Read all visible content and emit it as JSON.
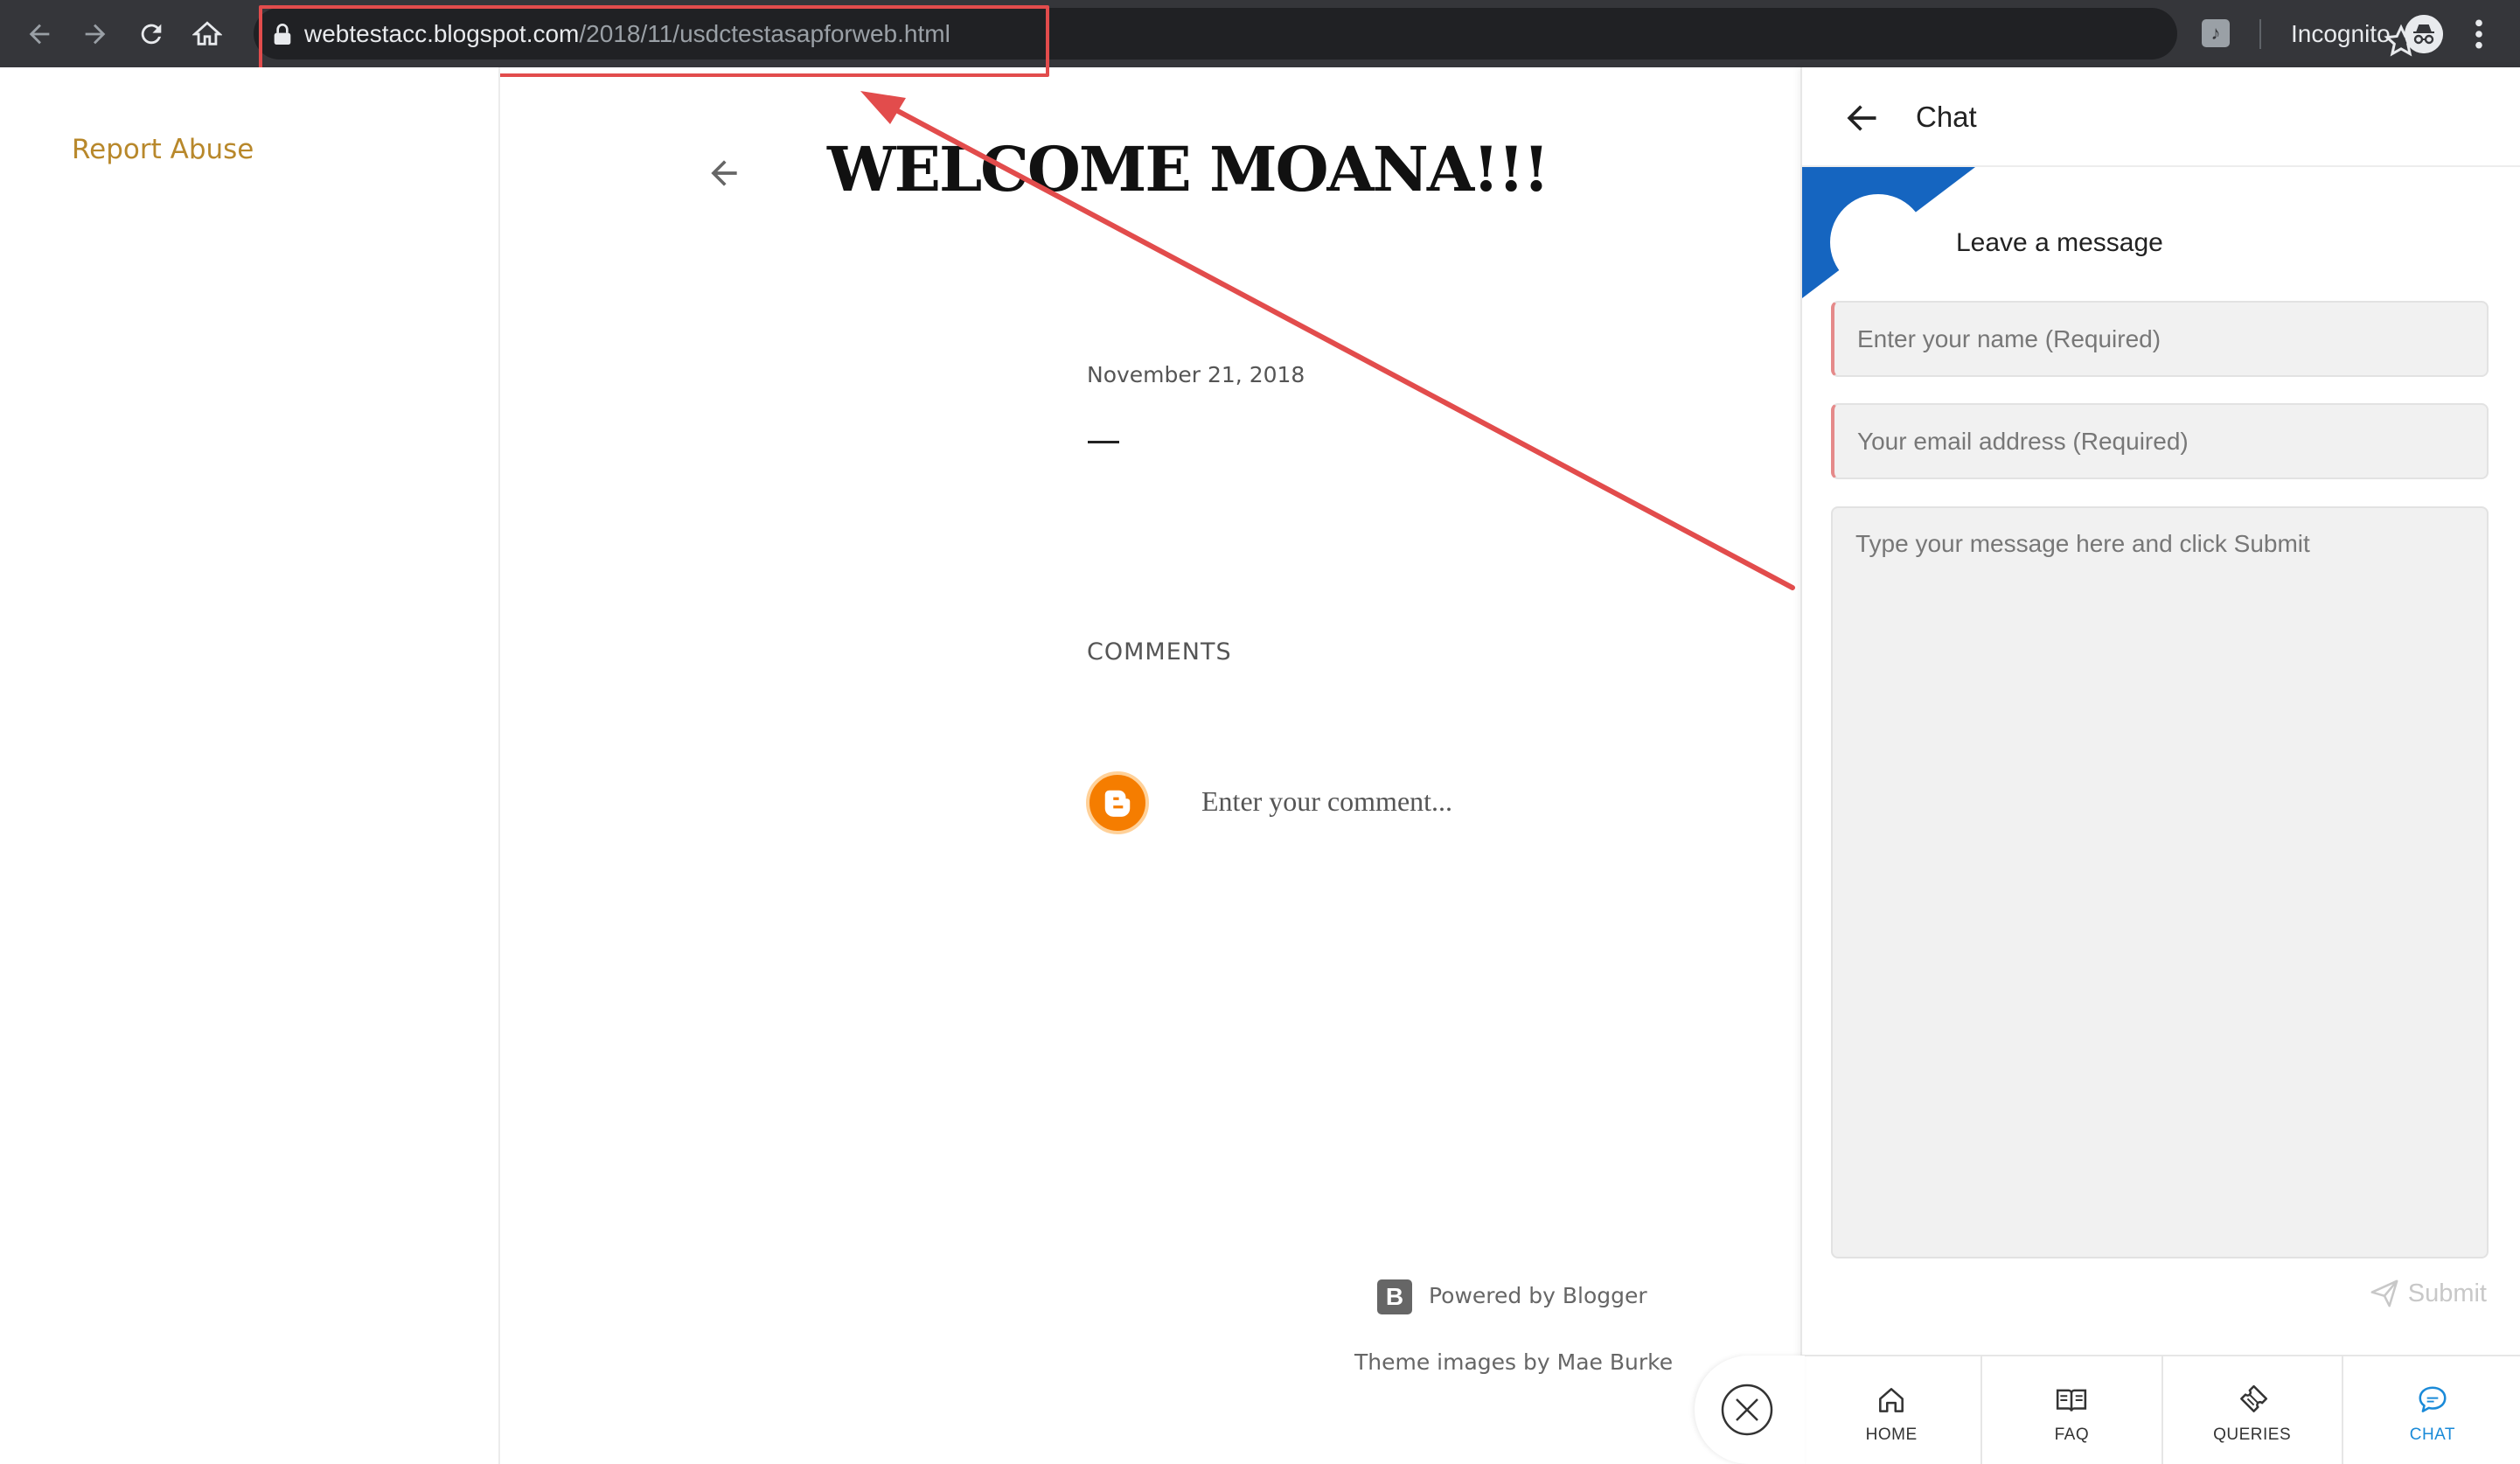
{
  "browser": {
    "url_host": "webtestacc.blogspot.com",
    "url_path": "/2018/11/usdctestasapforweb.html",
    "incognito_label": "Incognito",
    "icons": [
      "back-icon",
      "forward-icon",
      "reload-icon",
      "home-icon",
      "lock-icon",
      "star-icon",
      "extension-icon",
      "incognito-icon",
      "menu-icon"
    ]
  },
  "sidebar": {
    "report_abuse": "Report Abuse"
  },
  "post": {
    "title": "WELCOME MOANA!!!",
    "date": "November 21, 2018"
  },
  "comments": {
    "heading": "COMMENTS",
    "placeholder": "Enter your comment..."
  },
  "footer": {
    "powered_by": "Powered by Blogger",
    "theme_images": "Theme images by Mae Burke"
  },
  "chat": {
    "title": "Chat",
    "leave_message": "Leave a message",
    "name_placeholder": "Enter your name (Required)",
    "email_placeholder": "Your email address (Required)",
    "message_placeholder": "Type your message here and click Submit",
    "submit_label": "Submit",
    "tabs": [
      {
        "label": "HOME",
        "icon": "home-icon"
      },
      {
        "label": "FAQ",
        "icon": "book-icon"
      },
      {
        "label": "QUERIES",
        "icon": "ticket-icon"
      },
      {
        "label": "CHAT",
        "icon": "chat-icon"
      }
    ],
    "active_tab": "CHAT"
  },
  "colors": {
    "chrome_bg": "#35363a",
    "report_abuse": "#b8882b",
    "chat_accent": "#1a8ad8",
    "chat_corner": "#1565c0",
    "annotation": "#e24c4c",
    "blogger_orange": "#f57d00"
  }
}
